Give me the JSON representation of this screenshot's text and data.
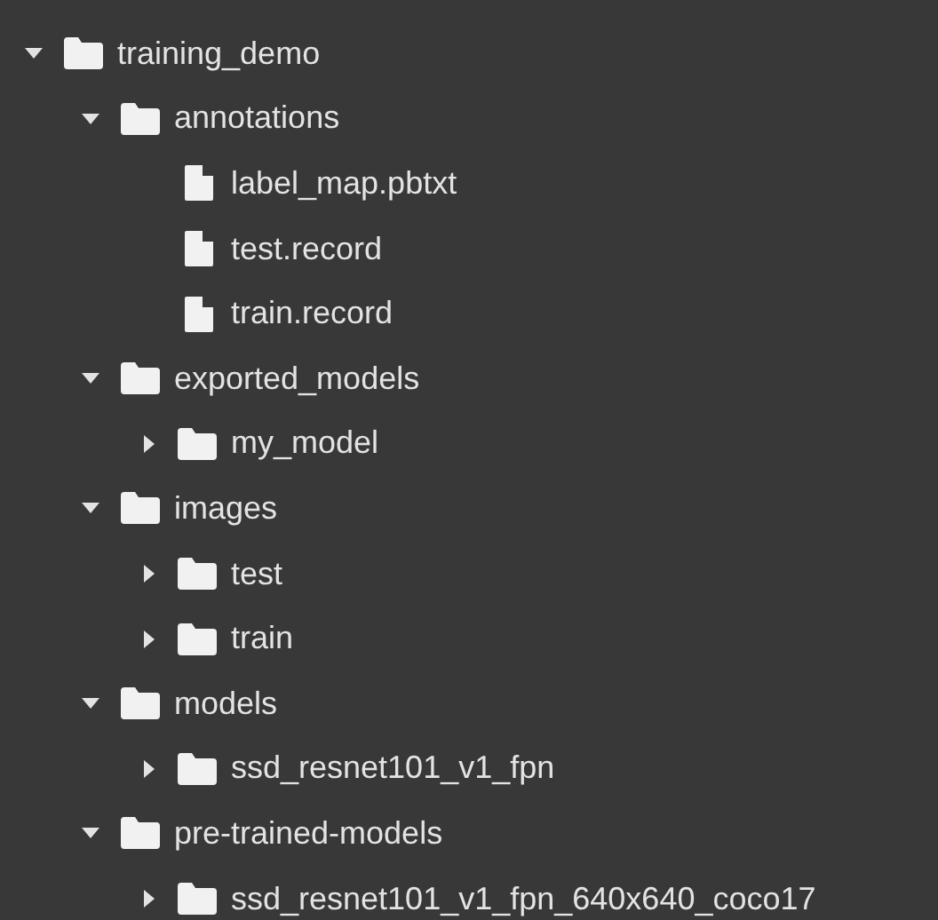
{
  "tree": [
    {
      "kind": "folder",
      "name": "training_demo",
      "expanded": true,
      "children": [
        {
          "kind": "folder",
          "name": "annotations",
          "expanded": true,
          "children": [
            {
              "kind": "file",
              "name": "label_map.pbtxt"
            },
            {
              "kind": "file",
              "name": "test.record"
            },
            {
              "kind": "file",
              "name": "train.record"
            }
          ]
        },
        {
          "kind": "folder",
          "name": "exported_models",
          "expanded": true,
          "children": [
            {
              "kind": "folder",
              "name": "my_model",
              "expanded": false
            }
          ]
        },
        {
          "kind": "folder",
          "name": "images",
          "expanded": true,
          "children": [
            {
              "kind": "folder",
              "name": "test",
              "expanded": false
            },
            {
              "kind": "folder",
              "name": "train",
              "expanded": false
            }
          ]
        },
        {
          "kind": "folder",
          "name": "models",
          "expanded": true,
          "children": [
            {
              "kind": "folder",
              "name": "ssd_resnet101_v1_fpn",
              "expanded": false
            }
          ]
        },
        {
          "kind": "folder",
          "name": "pre-trained-models",
          "expanded": true,
          "children": [
            {
              "kind": "folder",
              "name": "ssd_resnet101_v1_fpn_640x640_coco17",
              "expanded": false
            }
          ]
        }
      ]
    }
  ]
}
